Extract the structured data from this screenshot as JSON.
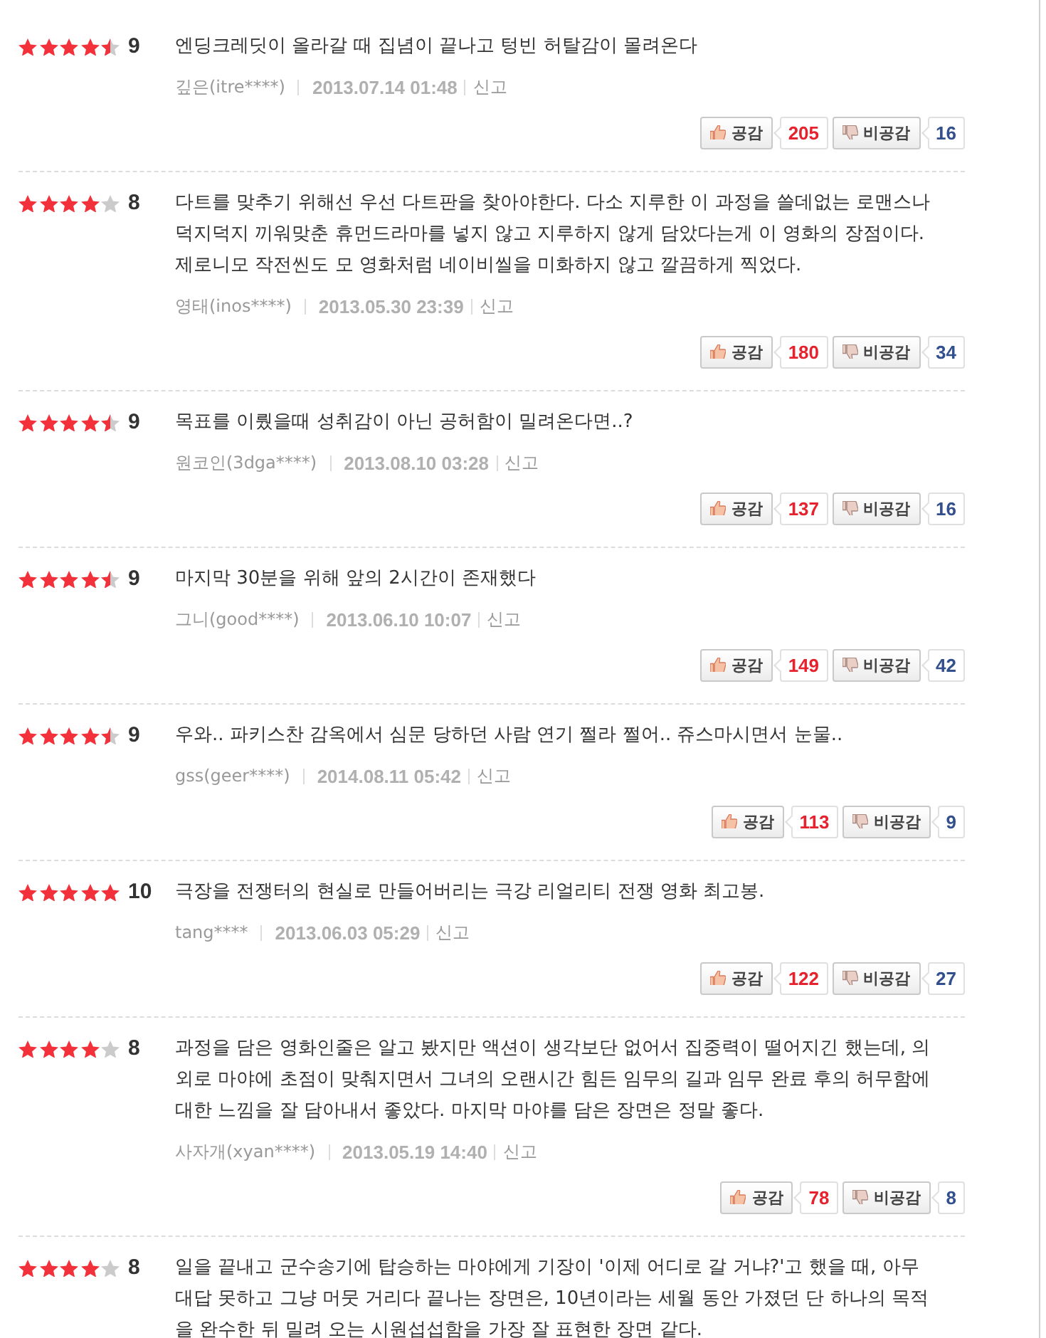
{
  "reviews": [
    {
      "stars": 4.5,
      "score": "9",
      "text": "엔딩크레딧이 올라갈 때 집념이 끝나고 텅빈 허탈감이 몰려온다",
      "author": "깊은(itre****)",
      "date": "2013.07.14 01:48",
      "report": "신고",
      "like_label": "공감",
      "likes": "205",
      "dislike_label": "비공감",
      "dislikes": "16"
    },
    {
      "stars": 4,
      "score": "8",
      "text": "다트를 맞추기 위해선 우선 다트판을 찾아야한다. 다소 지루한 이 과정을 쓸데없는 로맨스나 덕지덕지 끼워맞춘 휴먼드라마를 넣지 않고 지루하지 않게 담았다는게 이 영화의 장점이다. 제로니모 작전씬도 모 영화처럼 네이비씰을 미화하지 않고 깔끔하게 찍었다.",
      "author": "영태(inos****)",
      "date": "2013.05.30 23:39",
      "report": "신고",
      "like_label": "공감",
      "likes": "180",
      "dislike_label": "비공감",
      "dislikes": "34"
    },
    {
      "stars": 4.5,
      "score": "9",
      "text": "목표를 이뤘을때 성취감이 아닌 공허함이 밀려온다면..?",
      "author": "원코인(3dga****)",
      "date": "2013.08.10 03:28",
      "report": "신고",
      "like_label": "공감",
      "likes": "137",
      "dislike_label": "비공감",
      "dislikes": "16"
    },
    {
      "stars": 4.5,
      "score": "9",
      "text": "마지막 30분을 위해 앞의 2시간이 존재했다",
      "author": "그니(good****)",
      "date": "2013.06.10 10:07",
      "report": "신고",
      "like_label": "공감",
      "likes": "149",
      "dislike_label": "비공감",
      "dislikes": "42"
    },
    {
      "stars": 4.5,
      "score": "9",
      "text": "우와.. 파키스찬 감옥에서 심문 당하던 사람 연기 쩔라 쩔어.. 쥬스마시면서 눈물..",
      "author": "gss(geer****)",
      "date": "2014.08.11 05:42",
      "report": "신고",
      "like_label": "공감",
      "likes": "113",
      "dislike_label": "비공감",
      "dislikes": "9"
    },
    {
      "stars": 5,
      "score": "10",
      "text": "극장을 전쟁터의 현실로 만들어버리는 극강 리얼리티 전쟁 영화 최고봉.",
      "author": "tang****",
      "date": "2013.06.03 05:29",
      "report": "신고",
      "like_label": "공감",
      "likes": "122",
      "dislike_label": "비공감",
      "dislikes": "27"
    },
    {
      "stars": 4,
      "score": "8",
      "text": "과정을 담은 영화인줄은 알고 봤지만 액션이 생각보단 없어서 집중력이 떨어지긴 했는데, 의외로 마야에 초점이 맞춰지면서 그녀의 오랜시간 힘든 임무의 길과 임무 완료 후의 허무함에 대한 느낌을 잘 담아내서 좋았다. 마지막 마야를 담은 장면은 정말 좋다.",
      "author": "사자개(xyan****)",
      "date": "2013.05.19 14:40",
      "report": "신고",
      "like_label": "공감",
      "likes": "78",
      "dislike_label": "비공감",
      "dislikes": "8"
    },
    {
      "stars": 4,
      "score": "8",
      "text": "일을 끝내고 군수송기에 탑승하는 마야에게 기장이 '이제 어디로 갈 거냐?'고 했을 때, 아무 대답 못하고 그냥 머뭇 거리다 끝나는 장면은, 10년이라는 세월 동안 가졌던 단 하나의 목적을 완수한 뒤 밀려 오는 시원섭섭함을 가장 잘 표현한 장면 같다."
    }
  ]
}
